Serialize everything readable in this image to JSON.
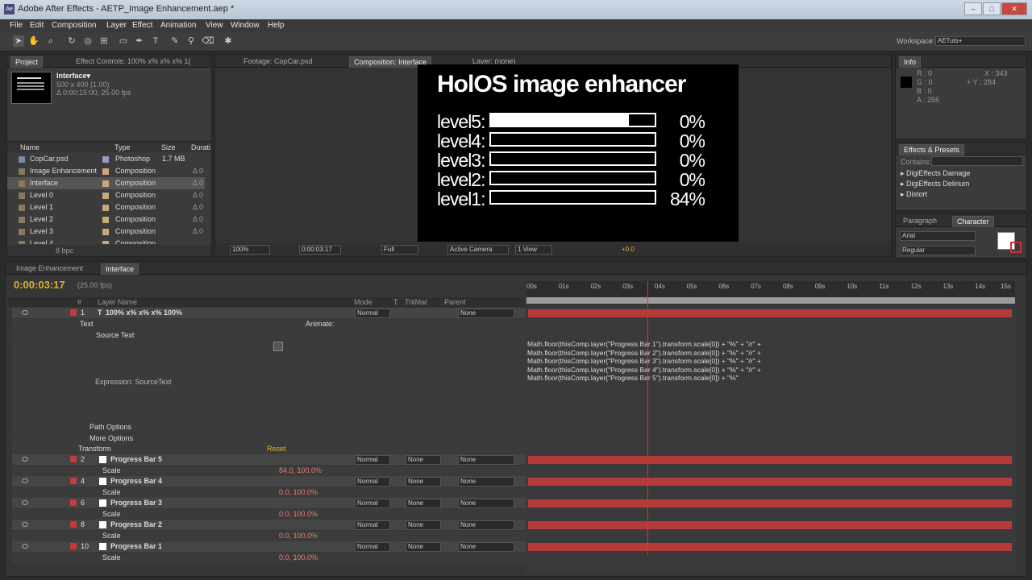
{
  "window": {
    "title": "Adobe After Effects - AETP_Image Enhancement.aep *",
    "app_icon": "Ae"
  },
  "menu": [
    "File",
    "Edit",
    "Composition",
    "Layer",
    "Effect",
    "Animation",
    "View",
    "Window",
    "Help"
  ],
  "workspace": {
    "label": "Workspace:",
    "value": "AETuts+"
  },
  "project": {
    "tabs": [
      "Project",
      "Effect Controls: 100% x% x% x% 1("
    ],
    "selected_name": "Interface▾",
    "dims": "500 x 400 (1.00)",
    "duration": "Δ 0:00:15:00, 25.00 fps",
    "columns": [
      "Name",
      "Type",
      "Size",
      "Durati"
    ],
    "items": [
      {
        "name": "CopCar.psd",
        "type": "Photoshop",
        "size": "1.7 MB",
        "dur": ""
      },
      {
        "name": "Image Enhancement",
        "type": "Composition",
        "size": "",
        "dur": "Δ 0"
      },
      {
        "name": "Interface",
        "type": "Composition",
        "size": "",
        "dur": "Δ 0"
      },
      {
        "name": "Level 0",
        "type": "Composition",
        "size": "",
        "dur": "Δ 0"
      },
      {
        "name": "Level 1",
        "type": "Composition",
        "size": "",
        "dur": "Δ 0"
      },
      {
        "name": "Level 2",
        "type": "Composition",
        "size": "",
        "dur": "Δ 0"
      },
      {
        "name": "Level 3",
        "type": "Composition",
        "size": "",
        "dur": "Δ 0"
      },
      {
        "name": "Level 4",
        "type": "Composition",
        "size": "",
        "dur": ""
      }
    ],
    "bpc": "8 bpc"
  },
  "viewer": {
    "tabs": [
      "Footage: CopCar.psd",
      "Composition: Interface",
      "Layer: (none)"
    ],
    "comp_title": "HolOS image enhancer",
    "levels": [
      {
        "label": "level5:",
        "pct": "0%",
        "fill": 0.84
      },
      {
        "label": "level4:",
        "pct": "0%",
        "fill": 0
      },
      {
        "label": "level3:",
        "pct": "0%",
        "fill": 0
      },
      {
        "label": "level2:",
        "pct": "0%",
        "fill": 0
      },
      {
        "label": "level1:",
        "pct": "84%",
        "fill": 0
      }
    ],
    "zoom": "100%",
    "timecode": "0:00:03:17",
    "resolution": "Full",
    "camera": "Active Camera",
    "views": "1 View",
    "exposure": "+0.0"
  },
  "info": {
    "tab": "Info",
    "r": "R : 0",
    "g": "G : 0",
    "b": "B : 0",
    "a": "A : 255",
    "x": "X : 343",
    "y": "+ Y : 284"
  },
  "effects_presets": {
    "tab": "Effects & Presets",
    "contains_label": "Contains:",
    "items": [
      "DigiEffects Damage",
      "DigiEffects Delirium",
      "Distort"
    ]
  },
  "character": {
    "tabs": [
      "Paragraph",
      "Character"
    ],
    "font": "Arial",
    "style": "Regular"
  },
  "timeline": {
    "tabs": [
      "Image Enhancement",
      "Interface"
    ],
    "timecode": "0:00:03:17",
    "fps": "(25.00 fps)",
    "headers": {
      "num": "#",
      "name": "Layer Name",
      "mode": "Mode",
      "t": "T",
      "trkmat": "TrkMat",
      "parent": "Parent"
    },
    "ruler": [
      "00s",
      "01s",
      "02s",
      "03s",
      "04s",
      "05s",
      "06s",
      "07s",
      "08s",
      "09s",
      "10s",
      "11s",
      "12s",
      "13s",
      "14s",
      "15s"
    ],
    "text_layer": {
      "num": "1",
      "name": "100% x% x% x% 100%",
      "mode": "Normal",
      "parent": "None"
    },
    "text_props": {
      "text": "Text",
      "animate": "Animate:",
      "source_text": "Source Text",
      "expression_label": "Expression: SourceText",
      "path_options": "Path Options",
      "more_options": "More Options",
      "transform": "Transform",
      "reset": "Reset"
    },
    "expression_lines": [
      "Math.floor(thisComp.layer(\"Progress Bar 1\").transform.scale[0]) + \"%\" + \"/r\" +",
      "Math.floor(thisComp.layer(\"Progress Bar 2\").transform.scale[0]) + \"%\" + \"/r\" +",
      "Math.floor(thisComp.layer(\"Progress Bar 3\").transform.scale[0]) + \"%\" + \"/r\" +",
      "Math.floor(thisComp.layer(\"Progress Bar 4\").transform.scale[0]) + \"%\" + \"/r\" +",
      "Math.floor(thisComp.layer(\"Progress Bar 5\").transform.scale[0]) + \"%\""
    ],
    "bar_layers": [
      {
        "num": "2",
        "name": "Progress Bar 5",
        "scale": "84.0, 100.0%"
      },
      {
        "num": "4",
        "name": "Progress Bar 4",
        "scale": "0.0, 100.0%"
      },
      {
        "num": "6",
        "name": "Progress Bar 3",
        "scale": "0.0, 100.0%"
      },
      {
        "num": "8",
        "name": "Progress Bar 2",
        "scale": "0.0, 100.0%"
      },
      {
        "num": "10",
        "name": "Progress Bar 1",
        "scale": "0.0, 100.0%"
      }
    ],
    "scale_label": "Scale",
    "mode": "Normal",
    "none": "None"
  }
}
